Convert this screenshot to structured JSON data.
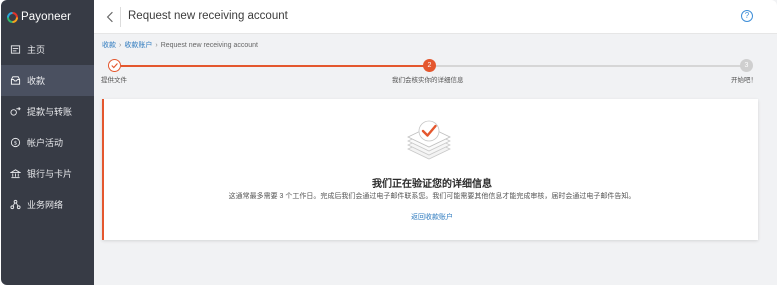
{
  "brand": {
    "name": "Payoneer"
  },
  "sidebar": {
    "items": [
      {
        "label": "主页",
        "icon": "home-icon"
      },
      {
        "label": "收款",
        "icon": "inbox-icon",
        "active": true
      },
      {
        "label": "提款与转账",
        "icon": "transfer-icon"
      },
      {
        "label": "帐户活动",
        "icon": "activity-icon"
      },
      {
        "label": "银行与卡片",
        "icon": "bank-card-icon"
      },
      {
        "label": "业务网络",
        "icon": "network-icon"
      }
    ]
  },
  "header": {
    "title": "Request new receiving account",
    "help_label": "?"
  },
  "breadcrumb": {
    "items": [
      "收款",
      "收款账户",
      "Request new receiving account"
    ]
  },
  "stepper": {
    "steps": [
      {
        "label": "提供文件",
        "number": "",
        "status": "done"
      },
      {
        "label": "我们会核实你的详细信息",
        "number": "2",
        "status": "current"
      },
      {
        "label": "开始吧！",
        "number": "3",
        "status": "pending"
      }
    ]
  },
  "card": {
    "title": "我们正在验证您的详细信息",
    "description": "这通常最多需要 3 个工作日。完成后我们会通过电子邮件联系您。我们可能需要其他信息才能完成审核，届时会通过电子邮件告知。",
    "link_label": "返回收款账户"
  },
  "colors": {
    "sidebar_bg": "#373b45",
    "accent": "#e4572e",
    "link": "#2f7bbf"
  }
}
